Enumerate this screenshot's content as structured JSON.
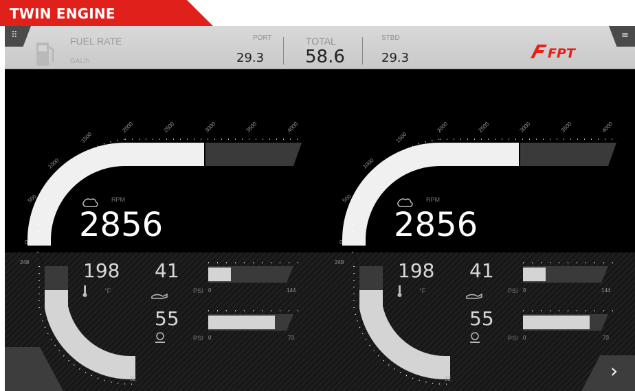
{
  "title": "TWIN ENGINE",
  "icons": {
    "grid": "grid-menu-icon",
    "menu": "hamburger-menu-icon",
    "pump": "fuel-pump-icon",
    "next": "chevron-right-icon"
  },
  "colors": {
    "accent_red": "#e0201a",
    "brand_red": "#e8201a",
    "warning_yellow": "#c89a1a"
  },
  "fuel": {
    "label": "FUEL RATE",
    "unit": "GAL/h",
    "port_label": "PORT",
    "port_value": "29.3",
    "total_label": "TOTAL",
    "total_value": "58.6",
    "stbd_label": "STBD",
    "stbd_value": "29.3"
  },
  "logo": "FPT",
  "engines": [
    {
      "rpm_label": "RPM",
      "rpm_value": "2856",
      "rpm_ticks": [
        "0",
        "500",
        "1000",
        "1500",
        "2000",
        "2500",
        "3000",
        "3500",
        "4000"
      ],
      "temp_value": "198",
      "temp_unit": "°F",
      "temp_max": "248",
      "temp_min": "32",
      "oil_value": "41",
      "oil_unit": "PSI",
      "oil_min": "0",
      "oil_max": "144",
      "oil_fraction": 0.28,
      "boost_value": "55",
      "boost_unit": "PSI",
      "boost_min": "0",
      "boost_max": "73",
      "boost_fraction": 0.82
    },
    {
      "rpm_label": "RPM",
      "rpm_value": "2856",
      "rpm_ticks": [
        "0",
        "500",
        "1000",
        "1500",
        "2000",
        "2500",
        "3000",
        "3500",
        "4000"
      ],
      "temp_value": "198",
      "temp_unit": "°F",
      "temp_max": "248",
      "temp_min": "32",
      "oil_value": "41",
      "oil_unit": "PSI",
      "oil_min": "0",
      "oil_max": "144",
      "oil_fraction": 0.28,
      "boost_value": "55",
      "boost_unit": "PSI",
      "boost_min": "0",
      "boost_max": "73",
      "boost_fraction": 0.82
    }
  ]
}
